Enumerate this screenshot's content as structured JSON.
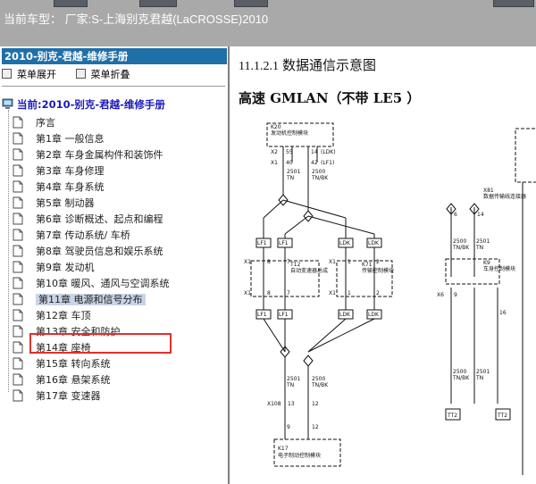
{
  "window": {
    "title": "当前车型： 厂家:S-上海别克君越(LaCROSSE)2010"
  },
  "sidebar": {
    "book_title": "2010-别克-君越-维修手册",
    "expand_label": "菜单展开",
    "collapse_label": "菜单折叠",
    "root_label": "当前:2010-别克-君越-维修手册",
    "items": [
      {
        "label": "序言"
      },
      {
        "label": "第1章 一般信息"
      },
      {
        "label": "第2章 车身金属构件和装饰件"
      },
      {
        "label": "第3章 车身修理"
      },
      {
        "label": "第4章 车身系统"
      },
      {
        "label": "第5章 制动器"
      },
      {
        "label": "第6章 诊断概述、起点和编程"
      },
      {
        "label": "第7章 传动系统/ 车桥"
      },
      {
        "label": "第8章 驾驶员信息和娱乐系统"
      },
      {
        "label": "第9章 发动机"
      },
      {
        "label": "第10章 暖风、通风与空调系统"
      },
      {
        "label": "第11章 电源和信号分布",
        "selected": true
      },
      {
        "label": "第12章 车顶"
      },
      {
        "label": "第13章 安全和防护"
      },
      {
        "label": "第14章 座椅"
      },
      {
        "label": "第15章 转向系统"
      },
      {
        "label": "第16章 悬架系统"
      },
      {
        "label": "第17章 变速器"
      }
    ]
  },
  "content": {
    "section_number": "11.1.2.1",
    "section_title": "数据通信示意图",
    "subheading": "高速 GMLAN（不带 LE5 ）",
    "diagram": {
      "k20_label": "K20",
      "k20_desc": "发动机控制模块",
      "x1": "X1",
      "x2": "X2",
      "x4": "X4",
      "p55": "55",
      "p40": "40",
      "p14": "14",
      "p42": "42",
      "ldk": "(LDK)",
      "lf1": "(LF1)",
      "w2501": "2501",
      "tn": "TN",
      "w2500": "2500",
      "tnbk": "TN/BK",
      "ldk_tag": "LDK",
      "lf1_tag": "LF1",
      "t12": "T12",
      "t12_desc": "自动变速器总成",
      "k71": "K71",
      "k71_desc": "传输控制模块",
      "p8": "8",
      "p7": "7",
      "p1": "1",
      "p2": "2",
      "p13": "13",
      "p12": "12",
      "x108": "X108",
      "k17": "K17",
      "k17_desc": "电子制动控制模块",
      "x81": "X81",
      "x81_desc": "数据传输线连接器",
      "k9": "K9",
      "k9_desc": "车身控制模块",
      "x6": "X6",
      "p6": "6",
      "p9": "9",
      "p16": "16",
      "tt2": "TT2"
    }
  }
}
